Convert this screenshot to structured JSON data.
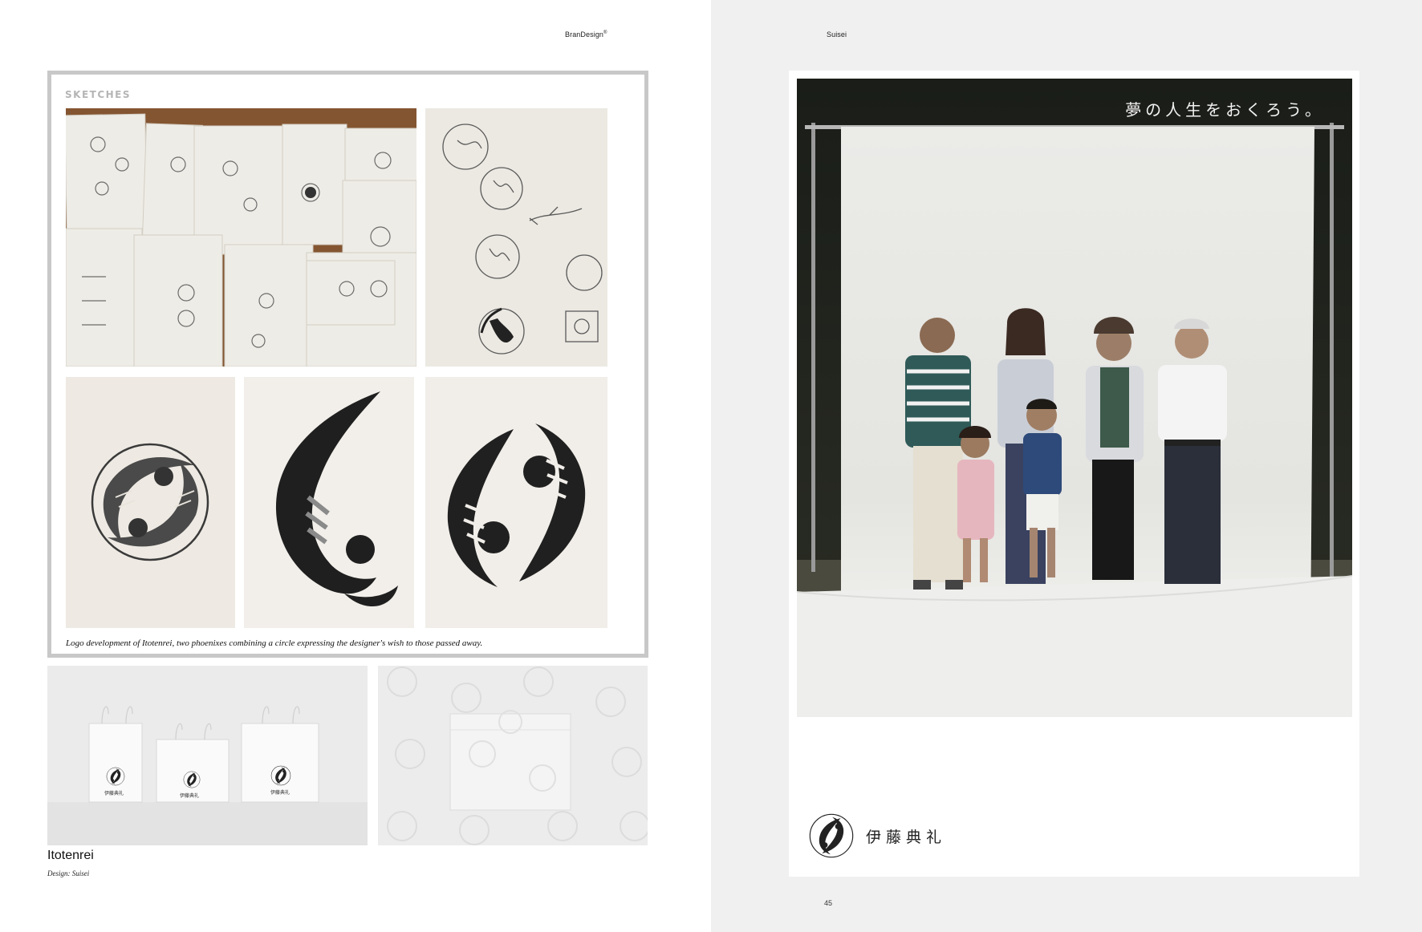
{
  "header": {
    "left_running_head": "BranDesign",
    "left_running_head_mark": "®",
    "right_running_head": "Suisei"
  },
  "sketches": {
    "title": "SKETCHES",
    "caption": "Logo development of Itotenrei, two phoenixes combining a circle expressing the designer's wish to those passed away."
  },
  "project": {
    "name": "Itotenrei",
    "credit": "Design: Suisei"
  },
  "poster": {
    "slogan": "夢の人生をおくろう。",
    "brand_name": "伊藤典礼"
  },
  "bag_label": "伊藤典礼",
  "page_number": "45",
  "colors": {
    "sketch_border": "#c8c8c8",
    "right_page_bg": "#f0f0f0",
    "logo_ink": "#222222"
  }
}
